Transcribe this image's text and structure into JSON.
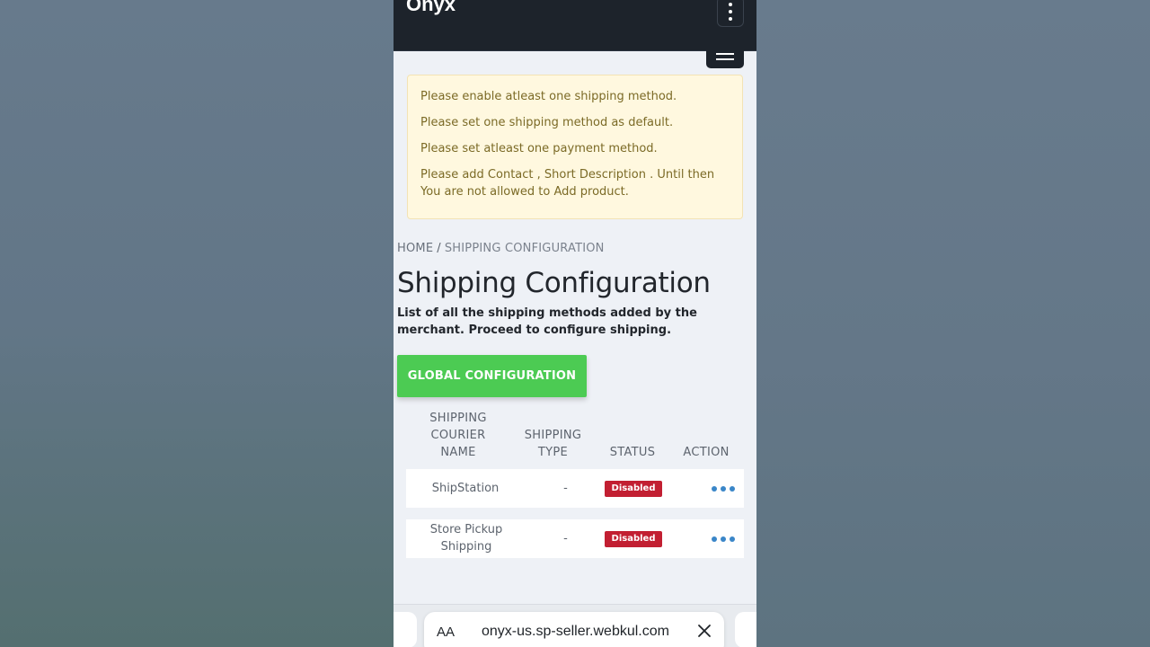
{
  "app": {
    "brand": "Onyx"
  },
  "alerts": [
    "Please enable atleast one shipping method.",
    "Please set one shipping method as default.",
    "Please set atleast one payment method.",
    "Please add Contact , Short Description . Until then You are not allowed to Add product."
  ],
  "breadcrumb": {
    "home": "HOME",
    "separator": "/",
    "current": "SHIPPING CONFIGURATION"
  },
  "page": {
    "title": "Shipping Configuration",
    "subtitle": "List of all the shipping methods added by the merchant. Proceed to configure shipping.",
    "global_button": "GLOBAL CONFIGURATION"
  },
  "table": {
    "headers": [
      "SHIPPING COURIER NAME",
      "SHIPPING TYPE",
      "STATUS",
      "ACTION"
    ],
    "rows": [
      {
        "name": "ShipStation",
        "type": "-",
        "status": "Disabled"
      },
      {
        "name": "Store Pickup Shipping",
        "type": "-",
        "status": "Disabled"
      }
    ]
  },
  "browser": {
    "aa_label": "AA",
    "url": "onyx-us.sp-seller.webkul.com"
  },
  "colors": {
    "topbar": "#1d232b",
    "accent_green": "#4ccb53",
    "status_disabled": "#c21f32",
    "action_dots": "#3a86c8",
    "alert_bg": "#fff8df"
  },
  "icons": [
    "kebab-menu-icon",
    "hamburger-menu-icon",
    "more-actions-icon",
    "close-icon"
  ]
}
